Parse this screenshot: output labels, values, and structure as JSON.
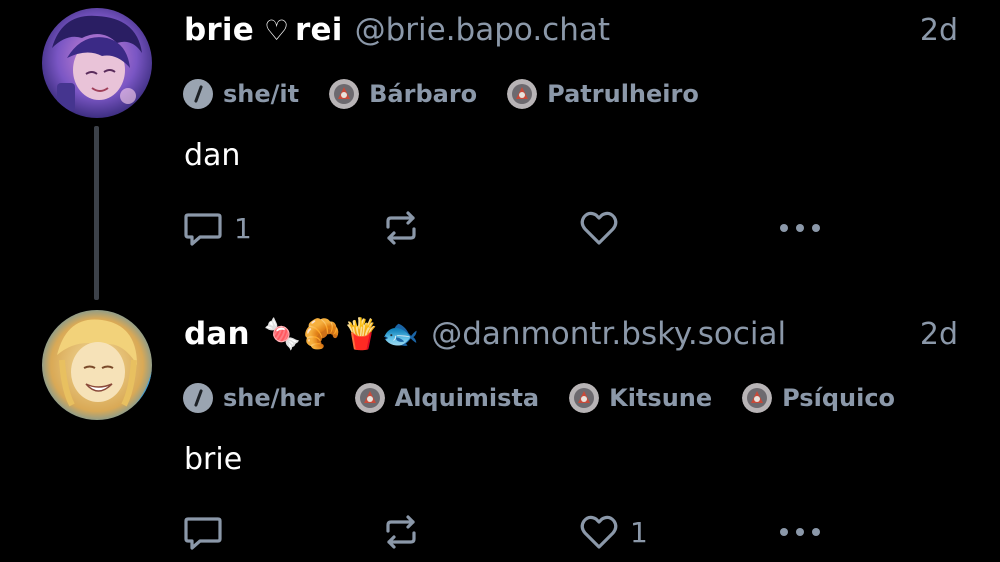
{
  "posts": [
    {
      "display_name_part1": "brie",
      "heart_symbol": "♡",
      "display_name_part2": "rei",
      "handle": "@brie.bapo.chat",
      "timestamp": "2d",
      "tags": [
        {
          "label": "she/it",
          "icon": "pronoun-icon"
        },
        {
          "label": "Bárbaro",
          "icon": "badge-icon"
        },
        {
          "label": "Patrulheiro",
          "icon": "badge-icon"
        }
      ],
      "text": "dan",
      "actions": {
        "reply_count": "1",
        "repost_count": "",
        "like_count": ""
      }
    },
    {
      "display_name": "dan",
      "emojis": [
        "🍬",
        "🥐",
        "🍟",
        "🐟"
      ],
      "handle": "@danmontr.bsky.social",
      "timestamp": "2d",
      "tags": [
        {
          "label": "she/her",
          "icon": "pronoun-icon"
        },
        {
          "label": "Alquimista",
          "icon": "badge-icon"
        },
        {
          "label": "Kitsune",
          "icon": "badge-icon"
        },
        {
          "label": "Psíquico",
          "icon": "badge-icon"
        }
      ],
      "text": "brie",
      "actions": {
        "reply_count": "",
        "repost_count": "",
        "like_count": "1"
      }
    }
  ],
  "colors": {
    "background": "#000000",
    "primary_text": "#ffffff",
    "secondary_text": "#8b98a9",
    "thread_line": "#3c4149"
  }
}
